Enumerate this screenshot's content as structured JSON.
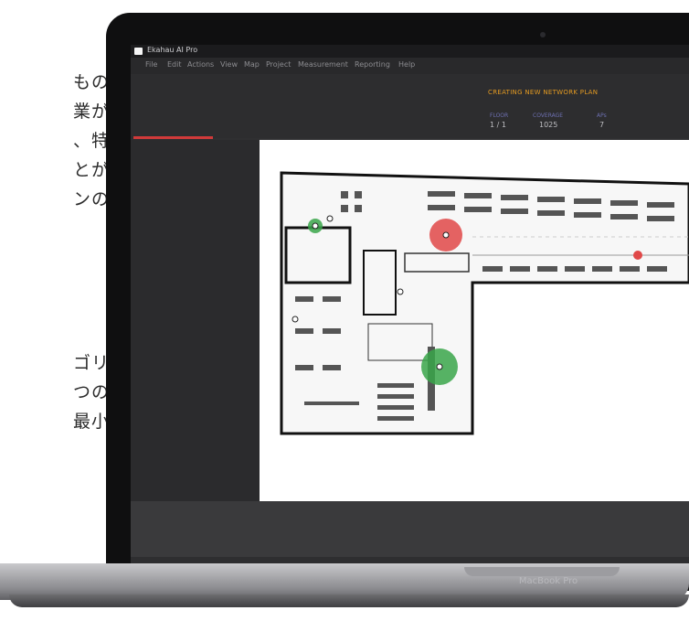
{
  "marketing_text": {
    "lines": [
      "もの",
      "業が",
      "、特",
      "とが",
      "ンの",
      "ゴリ",
      "つの",
      "最小"
    ]
  },
  "laptop": {
    "brand_label": "MacBook Pro"
  },
  "app": {
    "title": "Ekahau AI Pro",
    "menu": [
      "File",
      "Edit",
      "Actions",
      "View",
      "Map",
      "Project",
      "Measurement",
      "Reporting",
      "Help"
    ],
    "project_title": "CREATING NEW NETWORK PLAN",
    "stats": [
      {
        "label": "FLOOR",
        "value": "1 / 1"
      },
      {
        "label": "COVERAGE",
        "value": "1025"
      },
      {
        "label": "APs",
        "value": "7"
      }
    ],
    "colors": {
      "accent_orange": "#e39a22",
      "progress_red": "#d03a3a",
      "ap_red": "#e04848",
      "ap_green": "#3aa64a"
    }
  }
}
